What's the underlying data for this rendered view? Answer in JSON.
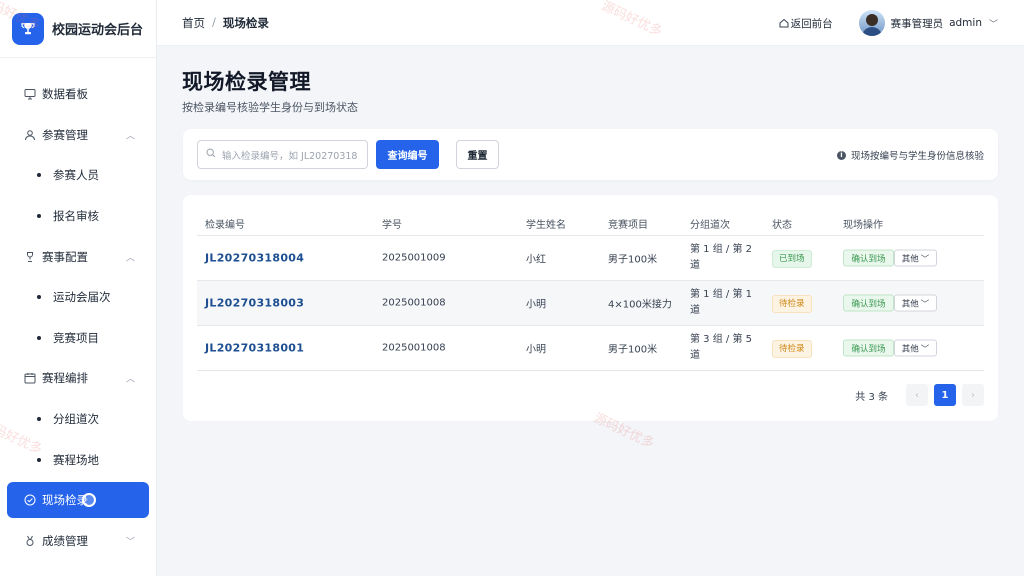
{
  "app": {
    "title": "校园运动会后台"
  },
  "sidebar": {
    "items": [
      {
        "label": "数据看板",
        "type": "top"
      },
      {
        "label": "参赛管理",
        "type": "group"
      },
      {
        "label": "参赛人员",
        "type": "sub"
      },
      {
        "label": "报名审核",
        "type": "sub"
      },
      {
        "label": "赛事配置",
        "type": "group"
      },
      {
        "label": "运动会届次",
        "type": "sub"
      },
      {
        "label": "竞赛项目",
        "type": "sub"
      },
      {
        "label": "赛程编排",
        "type": "group"
      },
      {
        "label": "分组道次",
        "type": "sub"
      },
      {
        "label": "赛程场地",
        "type": "sub"
      },
      {
        "label": "现场检录",
        "type": "active"
      },
      {
        "label": "成绩管理",
        "type": "group-collapsed"
      }
    ]
  },
  "topbar": {
    "crumb_home": "首页",
    "crumb_sep": "/",
    "crumb_current": "现场检录",
    "back_label": "返回前台",
    "role": "赛事管理员",
    "username": "admin"
  },
  "page": {
    "title": "现场检录管理",
    "subtitle": "按检录编号核验学生身份与到场状态"
  },
  "search": {
    "placeholder": "输入检录编号，如 JL20270318",
    "query_button": "查询编号",
    "reset_button": "重置",
    "hint": "现场按编号与学生身份信息核验"
  },
  "table": {
    "headers": [
      "检录编号",
      "学号",
      "学生姓名",
      "竞赛项目",
      "分组道次",
      "状态",
      "现场操作"
    ],
    "rows": [
      {
        "code": "JL20270318004",
        "student_no": "2025001009",
        "name": "小红",
        "event": "男子100米",
        "group": "第 1 组 / 第 2 道",
        "status": "已到场",
        "status_type": "arrived",
        "confirm": "确认到场",
        "more": "其他"
      },
      {
        "code": "JL20270318003",
        "student_no": "2025001008",
        "name": "小明",
        "event": "4×100米接力",
        "group": "第 1 组 / 第 1 道",
        "status": "待检录",
        "status_type": "pending",
        "confirm": "确认到场",
        "more": "其他"
      },
      {
        "code": "JL20270318001",
        "student_no": "2025001008",
        "name": "小明",
        "event": "男子100米",
        "group": "第 3 组 / 第 5 道",
        "status": "待检录",
        "status_type": "pending",
        "confirm": "确认到场",
        "more": "其他"
      }
    ]
  },
  "pagination": {
    "total": "共 3 条",
    "current": "1",
    "prev": "‹",
    "next": "›"
  },
  "watermark": "源码好优多",
  "colors": {
    "primary": "#2563eb",
    "arrived": "#3b9a52",
    "pending": "#d08a1c",
    "code": "#1d4f91"
  }
}
